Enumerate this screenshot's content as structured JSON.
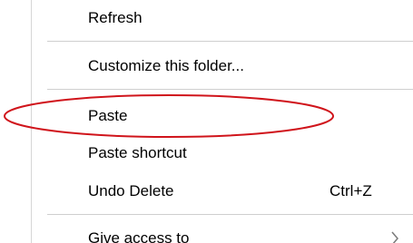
{
  "menu": {
    "items": [
      {
        "label": "Refresh"
      },
      {
        "label": "Customize this folder..."
      },
      {
        "label": "Paste"
      },
      {
        "label": "Paste shortcut"
      },
      {
        "label": "Undo Delete",
        "shortcut": "Ctrl+Z"
      },
      {
        "label": "Give access to"
      }
    ],
    "submenu_arrow_icon": "chevron-right-icon"
  },
  "annotation": {
    "shape": "ellipse",
    "color": "#d0141b",
    "target": "Paste"
  }
}
